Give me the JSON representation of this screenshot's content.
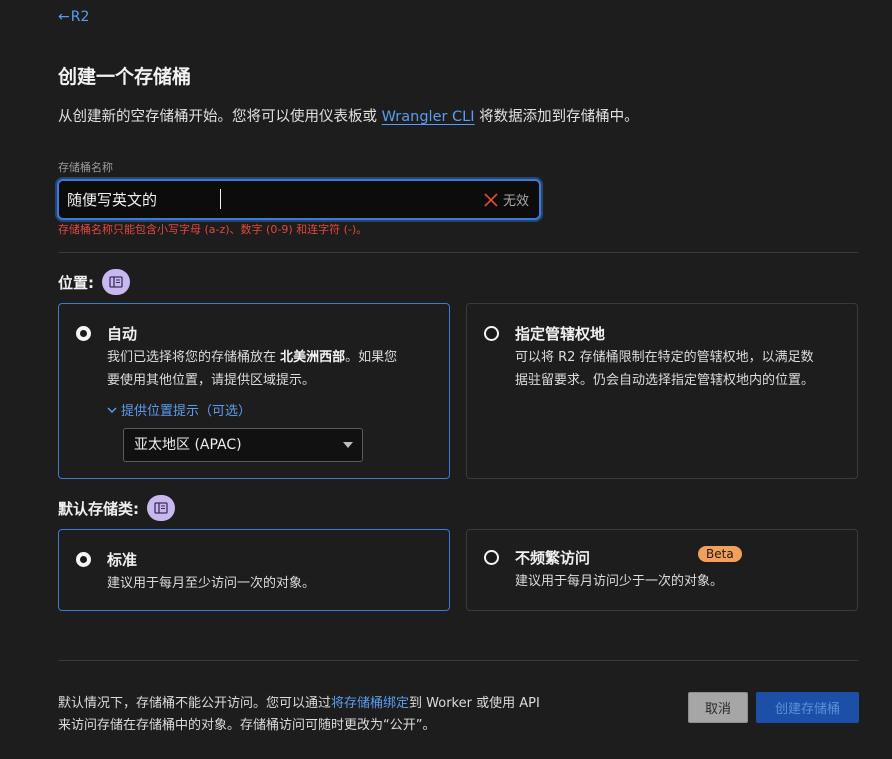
{
  "nav": {
    "back_label": "R2"
  },
  "page": {
    "title": "创建一个存储桶",
    "subtitle_before": "从创建新的空存储桶开始。您将可以使用仪表板或 ",
    "subtitle_link": "Wrangler CLI",
    "subtitle_after": " 将数据添加到存储桶中。"
  },
  "bucket_name": {
    "label": "存储桶名称",
    "value": "随便写英文的",
    "invalid_label": "无效",
    "error": "存储桶名称只能包含小写字母 (a-z)、数字 (0-9) 和连字符 (-)。"
  },
  "location": {
    "title": "位置:",
    "options": [
      {
        "title": "自动",
        "desc_1": "我们已选择将您的存储桶放在 ",
        "desc_bold": "北美洲西部",
        "desc_2": "。如果您",
        "desc_line2": "要使用其他位置，请提供区域提示。",
        "selected": true
      },
      {
        "title": "指定管辖权地",
        "desc_line1": "可以将 R2 存储桶限制在特定的管辖权地，以满足数",
        "desc_line2": "据驻留要求。仍会自动选择指定管辖权地内的位置。",
        "selected": false
      }
    ],
    "hint_toggle": "提供位置提示（可选）",
    "region_value": "亚太地区 (APAC)"
  },
  "storage_class": {
    "title": "默认存储类:",
    "options": [
      {
        "title": "标准",
        "desc": "建议用于每月至少访问一次的对象。",
        "selected": true
      },
      {
        "title": "不频繁访问",
        "badge": "Beta",
        "desc": "建议用于每月访问少于一次的对象。",
        "selected": false
      }
    ]
  },
  "footer": {
    "note_1": "默认情况下，存储桶不能公开访问。您可以通过",
    "note_link": "将存储桶绑定",
    "note_2": "到 Worker 或使用 API",
    "note_line2": "来访问存储在存储桶中的对象。存储桶访问可随时更改为“公开”。",
    "cancel_label": "取消",
    "create_label": "创建存储桶"
  },
  "colors": {
    "accent": "#3b7ad8",
    "error": "#e0483c",
    "badge": "#f0a05a",
    "info": "#c9b8f0"
  },
  "icons": [
    "arrow-left-icon",
    "x-icon",
    "book-icon",
    "chevron-down-icon",
    "caret-down-icon"
  ]
}
